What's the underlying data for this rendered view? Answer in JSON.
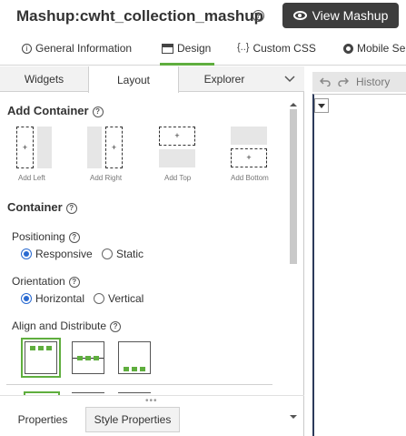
{
  "header": {
    "title_prefix": "Mashup:",
    "title_name": "cwht_collection_mashup",
    "info_glyph": "?",
    "view_button": "View Mashup"
  },
  "top_tabs": [
    {
      "label": "General Information",
      "icon": "info-icon"
    },
    {
      "label": "Design",
      "icon": "design-icon",
      "active": true
    },
    {
      "label": "Custom CSS",
      "icon_text": "{..}"
    },
    {
      "label": "Mobile Se",
      "icon": "gear-icon"
    }
  ],
  "sub_tabs": [
    {
      "label": "Widgets"
    },
    {
      "label": "Layout",
      "active": true
    },
    {
      "label": "Explorer"
    }
  ],
  "layout": {
    "add_container_title": "Add Container",
    "add_options": [
      {
        "caption": "Add Left"
      },
      {
        "caption": "Add Right"
      },
      {
        "caption": "Add Top"
      },
      {
        "caption": "Add Bottom"
      }
    ],
    "plus_glyph": "+",
    "container_title": "Container",
    "positioning_label": "Positioning",
    "positioning_options": [
      "Responsive",
      "Static"
    ],
    "positioning_selected": "Responsive",
    "orientation_label": "Orientation",
    "orientation_options": [
      "Horizontal",
      "Vertical"
    ],
    "orientation_selected": "Horizontal",
    "align_label": "Align and Distribute"
  },
  "bottom_tabs": [
    {
      "label": "Properties",
      "active": true
    },
    {
      "label": "Style Properties"
    }
  ],
  "right_panel": {
    "history_label": "History"
  },
  "colors": {
    "accent_green": "#5fae3e",
    "radio_blue": "#2a6ad1",
    "dark_button": "#3d3d3d"
  }
}
